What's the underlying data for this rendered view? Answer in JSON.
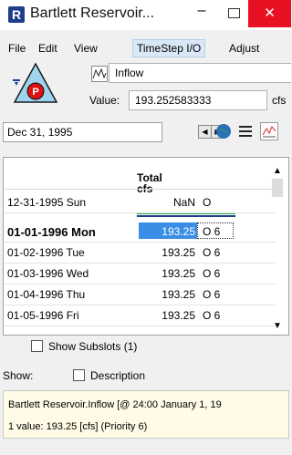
{
  "window": {
    "title": "Bartlett Reservoir...",
    "close_glyph": "✕",
    "min_glyph": "–"
  },
  "menu": {
    "file": "File",
    "edit": "Edit",
    "view": "View",
    "timestep": "TimeStep I/O",
    "adjust": "Adjust"
  },
  "slot": {
    "name": "Inflow",
    "value_label": "Value:",
    "value": "193.252583333",
    "units": "cfs"
  },
  "date": {
    "current": "Dec 31, 1995"
  },
  "table": {
    "header_line1": "Total",
    "header_line2": "cfs",
    "rows": [
      {
        "date": "12-31-1995 Sun",
        "value": "NaN",
        "flag": "O"
      },
      {
        "date": "01-01-1996 Mon",
        "value": "193.25",
        "flag": "O 6"
      },
      {
        "date": "01-02-1996 Tue",
        "value": "193.25",
        "flag": "O 6"
      },
      {
        "date": "01-03-1996 Wed",
        "value": "193.25",
        "flag": "O 6"
      },
      {
        "date": "01-04-1996 Thu",
        "value": "193.25",
        "flag": "O 6"
      },
      {
        "date": "01-05-1996 Fri",
        "value": "193.25",
        "flag": "O 6"
      }
    ]
  },
  "show_subslots": {
    "label": "Show Subslots (1)",
    "checked": false
  },
  "show": {
    "label": "Show:",
    "description_label": "Description",
    "checked": false
  },
  "info": {
    "line1": "Bartlett Reservoir.Inflow [@ 24:00 January 1, 19",
    "line2": "1 value:  193.25 [cfs]  (Priority 6)"
  },
  "colors": {
    "selection": "#3a8ee6",
    "close": "#e81123",
    "info_bg": "#fffbe6"
  }
}
